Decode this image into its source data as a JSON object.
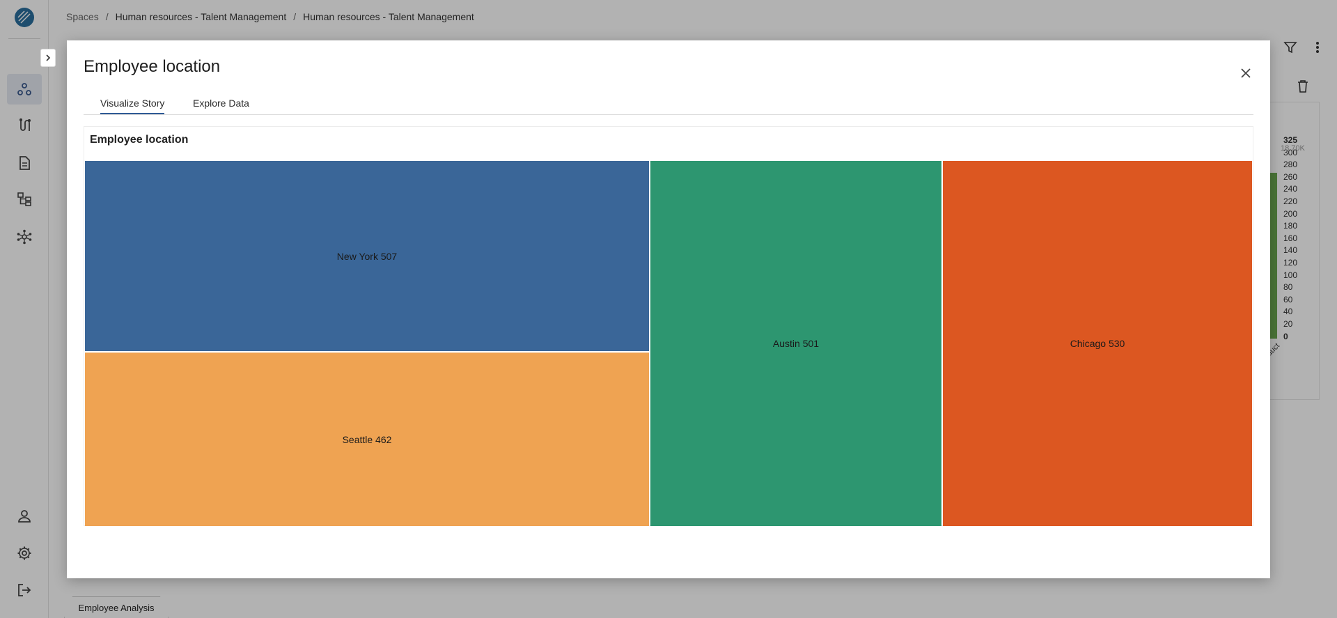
{
  "breadcrumb": {
    "items": [
      "Spaces",
      "Human resources - Talent Management",
      "Human resources - Talent Management"
    ]
  },
  "background_chart": {
    "axis_ticks": [
      "325",
      "300",
      "280",
      "260",
      "240",
      "220",
      "200",
      "180",
      "160",
      "140",
      "120",
      "100",
      "80",
      "60",
      "40",
      "20",
      "0"
    ],
    "secondary_label": "18.70K",
    "category_fragment": "duct"
  },
  "sheet_tabs": [
    "Employee Analysis"
  ],
  "modal": {
    "title": "Employee location",
    "tabs": [
      {
        "label": "Visualize Story",
        "active": true
      },
      {
        "label": "Explore Data",
        "active": false
      }
    ],
    "viz_title": "Employee location"
  },
  "chart_data": {
    "type": "treemap",
    "title": "Employee location",
    "items": [
      {
        "label": "New York 507",
        "name": "New York",
        "value": 507,
        "color": "#3a6698"
      },
      {
        "label": "Seattle 462",
        "name": "Seattle",
        "value": 462,
        "color": "#efa352"
      },
      {
        "label": "Austin 501",
        "name": "Austin",
        "value": 501,
        "color": "#2d9670"
      },
      {
        "label": "Chicago 530",
        "name": "Chicago",
        "value": 530,
        "color": "#dc5721"
      }
    ]
  }
}
